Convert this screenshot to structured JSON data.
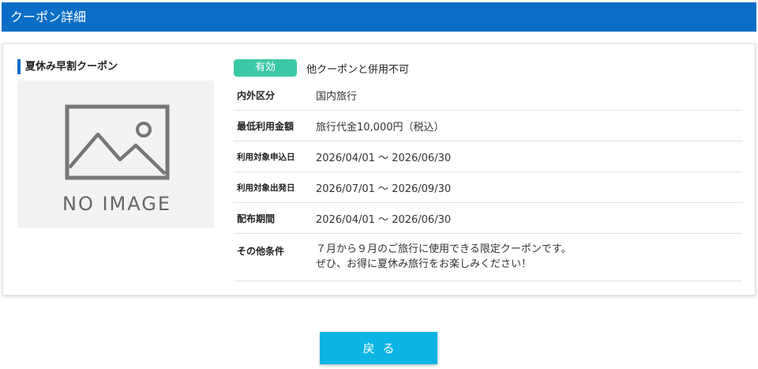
{
  "header": {
    "title": "クーポン詳細"
  },
  "coupon": {
    "name": "夏休み早割クーポン",
    "image_placeholder": "NO IMAGE",
    "status_badge": "有効",
    "combination_note": "他クーポンと併用不可",
    "details": [
      {
        "label": "内外区分",
        "value": "国内旅行"
      },
      {
        "label": "最低利用金額",
        "value": "旅行代金10,000円（税込）"
      },
      {
        "label": "利用対象申込日",
        "value": "2026/04/01 ～ 2026/06/30"
      },
      {
        "label": "利用対象出発日",
        "value": "2026/07/01 ～ 2026/09/30"
      },
      {
        "label": "配布期間",
        "value": "2026/04/01 ～ 2026/06/30"
      }
    ],
    "other_conditions": {
      "label": "その他条件",
      "line1": "７月から９月のご旅行に使用できる限定クーポンです。",
      "line2": "ぜひ、お得に夏休み旅行をお楽しみください！"
    }
  },
  "actions": {
    "back_label": "戻る"
  },
  "colors": {
    "header_bg": "#0a6ec6",
    "badge_bg": "#3bc8a5",
    "back_button_bg": "#0cb4e4"
  }
}
